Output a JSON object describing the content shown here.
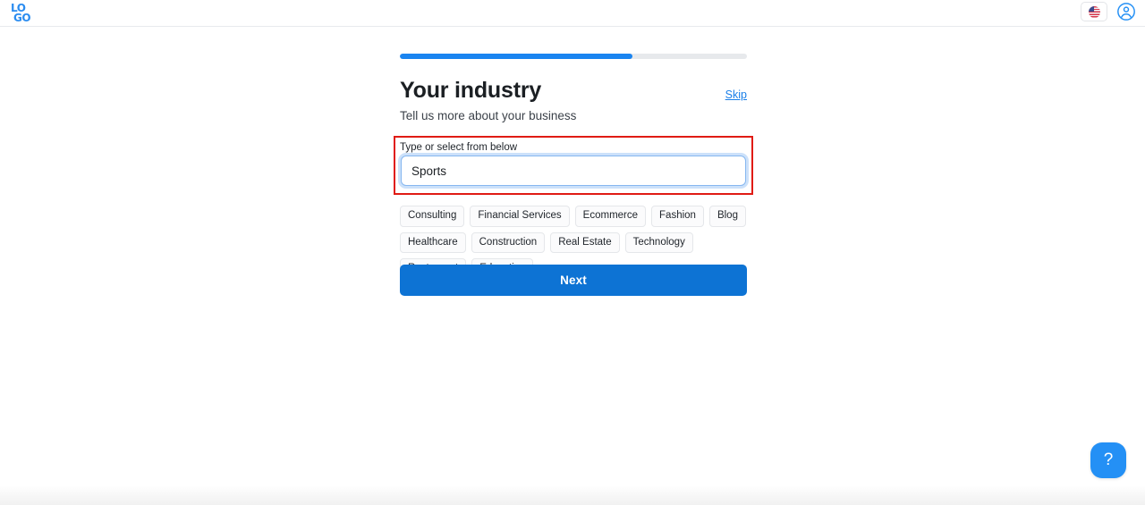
{
  "header": {
    "logo_top": "LO",
    "logo_bottom": "GO",
    "language_icon": "us-flag-icon",
    "account_icon": "account-circle-icon"
  },
  "onboarding": {
    "progress_percent": 67,
    "title": "Your industry",
    "skip_label": "Skip",
    "subtitle": "Tell us more about your business",
    "field_label": "Type or select from below",
    "input_value": "Sports",
    "input_placeholder": "Type or select from below",
    "chips": [
      "Consulting",
      "Financial Services",
      "Ecommerce",
      "Fashion",
      "Blog",
      "Healthcare",
      "Construction",
      "Real Estate",
      "Technology",
      "Restaurant",
      "Education"
    ],
    "next_label": "Next"
  },
  "help": {
    "label": "?"
  },
  "colors": {
    "accent_blue": "#1a84f0",
    "button_blue": "#0d73d4",
    "link_blue": "#1a7fe8",
    "highlight_red": "#e01b14",
    "track_gray": "#e7e9ec"
  }
}
